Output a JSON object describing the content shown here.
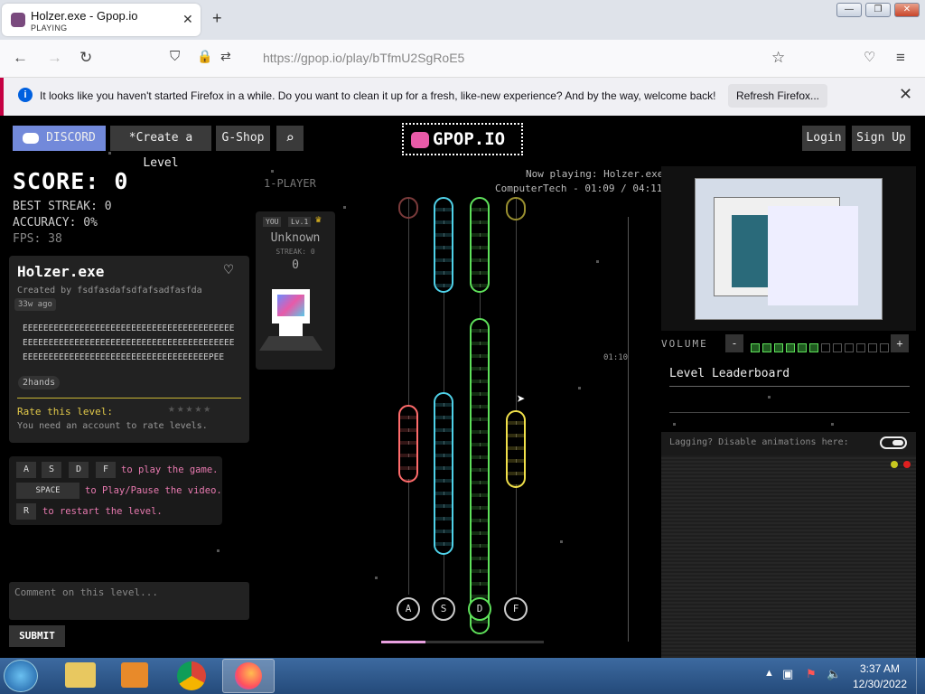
{
  "browser": {
    "tab_title": "Holzer.exe - Gpop.io",
    "tab_status": "PLAYING",
    "url": "https://gpop.io/play/bTfmU2SgRoE5",
    "notification": "It looks like you haven't started Firefox in a while. Do you want to clean it up for a fresh, like-new experience? And by the way, welcome back!",
    "refresh_button": "Refresh Firefox..."
  },
  "nav": {
    "discord": "DISCORD",
    "create": "*Create a Level",
    "shop": "G-Shop",
    "logo": "GPOP.IO",
    "login": "Login",
    "signup": "Sign Up"
  },
  "stats": {
    "score": "SCORE: 0",
    "best_streak": "BEST STREAK: 0",
    "accuracy": "ACCURACY: 0%",
    "fps": "FPS: 38"
  },
  "level": {
    "title": "Holzer.exe",
    "creator": "Created by fsdfasdafsdfafsadfasfda",
    "age": "33w ago",
    "description": "EEEEEEEEEEEEEEEEEEEEEEEEEEEEEEEEEEEEEEEEEEEEEEEEEEEEEEEEEEEEEEEEEEEEEEEEEEEEEEEEEEEEEEEEEEEEEEEEEEEEEEEEEEEEEEEEEEEEEEPEEE...",
    "tag": "2hands",
    "rate_label": "Rate this level:",
    "rate_note": "You need an account to rate levels."
  },
  "controls": {
    "keys": [
      "A",
      "S",
      "D",
      "F"
    ],
    "play_text": "to play the game.",
    "space": "SPACE",
    "space_text": "to Play/Pause the video.",
    "restart_key": "R",
    "restart_text": "to restart the level."
  },
  "comment": {
    "placeholder": "Comment on this level...",
    "submit": "SUBMIT"
  },
  "player": {
    "mode": "1-PLAYER",
    "you": "YOU",
    "level": "Lv.1",
    "name": "Unknown",
    "streak": "STREAK: 0",
    "score": "0"
  },
  "playback": {
    "now_playing": "Now playing: Holzer.exe",
    "time": "ComputerTech - 01:09 / 04:11",
    "marker": "01:10",
    "progress": 0.27
  },
  "lanes": [
    "A",
    "S",
    "D",
    "F"
  ],
  "right": {
    "volume_label": "VOLUME",
    "volume_level": 6,
    "volume_steps": 12,
    "leaderboard": "Level Leaderboard",
    "lagging": "Lagging? Disable animations here:"
  },
  "taskbar": {
    "time": "3:37 AM",
    "date": "12/30/2022"
  },
  "colors": {
    "discord": "#7289da",
    "lane_a": "#ff6b6b",
    "lane_s": "#4fd1e8",
    "lane_d": "#5ee05a",
    "lane_f": "#f0e04a",
    "accent": "#e85aa8"
  }
}
